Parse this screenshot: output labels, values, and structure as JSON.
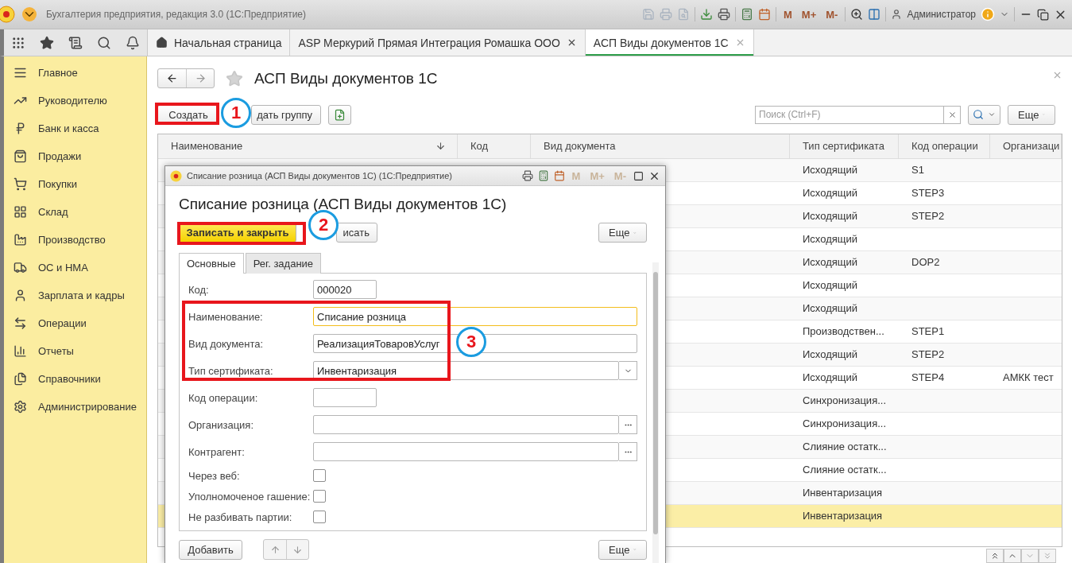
{
  "window": {
    "title": "Бухгалтерия предприятия, редакция 3.0  (1С:Предприятие)",
    "memory_buttons": [
      "M",
      "M+",
      "M-"
    ],
    "user": "Администратор"
  },
  "section_tabs": [
    {
      "label": "Начальная страница",
      "kind": "home",
      "selected": false
    },
    {
      "label": "ASP Меркурий Прямая Интеграция Ромашка ООО",
      "kind": "closable",
      "selected": false
    },
    {
      "label": "АСП Виды документов 1С",
      "kind": "closable",
      "selected": true
    }
  ],
  "sidebar": {
    "items": [
      {
        "label": "Главное"
      },
      {
        "label": "Руководителю"
      },
      {
        "label": "Банк и касса"
      },
      {
        "label": "Продажи"
      },
      {
        "label": "Покупки"
      },
      {
        "label": "Склад"
      },
      {
        "label": "Производство"
      },
      {
        "label": "ОС и НМА"
      },
      {
        "label": "Зарплата и кадры"
      },
      {
        "label": "Операции"
      },
      {
        "label": "Отчеты"
      },
      {
        "label": "Справочники"
      },
      {
        "label": "Администрирование"
      }
    ]
  },
  "list_form": {
    "title": "АСП Виды документов 1С",
    "toolbar": {
      "create": "Создать",
      "create_group": "дать группу",
      "search_placeholder": "Поиск (Ctrl+F)",
      "more": "Еще"
    },
    "table": {
      "columns": [
        "Наименование",
        "Код",
        "Вид документа",
        "Тип сертификата",
        "Код операции",
        "Организаци"
      ],
      "rows": [
        {
          "cert_type": "Исходящий",
          "op_code": "S1",
          "selected": false
        },
        {
          "cert_type": "Исходящий",
          "op_code": "STEP3",
          "selected": false
        },
        {
          "cert_type": "Исходящий",
          "op_code": "STEP2",
          "selected": false
        },
        {
          "cert_type": "Исходящий",
          "selected": false
        },
        {
          "cert_type": "Исходящий",
          "op_code": "DOP2",
          "selected": false
        },
        {
          "cert_type": "Исходящий",
          "selected": false
        },
        {
          "cert_type": "Исходящий",
          "selected": false
        },
        {
          "cert_type": "Производствен...",
          "op_code": "STEP1",
          "selected": false
        },
        {
          "cert_type": "Исходящий",
          "op_code": "STEP2",
          "selected": false
        },
        {
          "cert_type": "Исходящий",
          "op_code": "STEP4",
          "organization": "АМКК тест",
          "selected": false
        },
        {
          "cert_type": "Синхронизация...",
          "selected": false
        },
        {
          "cert_type": "Синхронизация...",
          "selected": false
        },
        {
          "cert_type": "Слияние остатк...",
          "selected": false
        },
        {
          "cert_type": "Слияние остатк...",
          "selected": false
        },
        {
          "cert_type": "Инвентаризация",
          "selected": false
        },
        {
          "cert_type": "Инвентаризация",
          "selected": true
        }
      ]
    }
  },
  "dialog": {
    "window_title": "Списание розница (АСП Виды документов 1С)  (1С:Предприятие)",
    "memory_buttons": [
      "M",
      "M+",
      "M-"
    ],
    "heading": "Списание розница (АСП Виды документов 1С)",
    "buttons": {
      "save_close": "Записать и закрыть",
      "save": "исать",
      "more": "Еще"
    },
    "tabs": [
      {
        "label": "Основные",
        "selected": true
      },
      {
        "label": "Рег. задание",
        "selected": false
      }
    ],
    "fields": [
      {
        "kind": "short",
        "label": "Код:",
        "value": "000020"
      },
      {
        "kind": "text",
        "label": "Наименование:",
        "value": "Списание розница",
        "focused": true
      },
      {
        "kind": "text",
        "label": "Вид документа:",
        "value": "РеализацияТоваровУслуг",
        "focused": false
      },
      {
        "kind": "select",
        "label": "Тип сертификата:",
        "value": "Инвентаризация"
      },
      {
        "kind": "short",
        "label": "Код операции:"
      },
      {
        "kind": "choice",
        "label": "Организация:"
      },
      {
        "kind": "choice",
        "label": "Контрагент:"
      },
      {
        "kind": "checkbox",
        "label": "Через веб:",
        "checked": false
      },
      {
        "kind": "checkbox",
        "label": "Уполномоченое гашение:",
        "checked": false
      },
      {
        "kind": "checkbox",
        "label": "Не разбивать партии:",
        "checked": false
      }
    ],
    "bottom": {
      "add": "Добавить",
      "more": "Еще"
    }
  },
  "annotations": [
    {
      "number": "1"
    },
    {
      "number": "2"
    },
    {
      "number": "3"
    }
  ]
}
